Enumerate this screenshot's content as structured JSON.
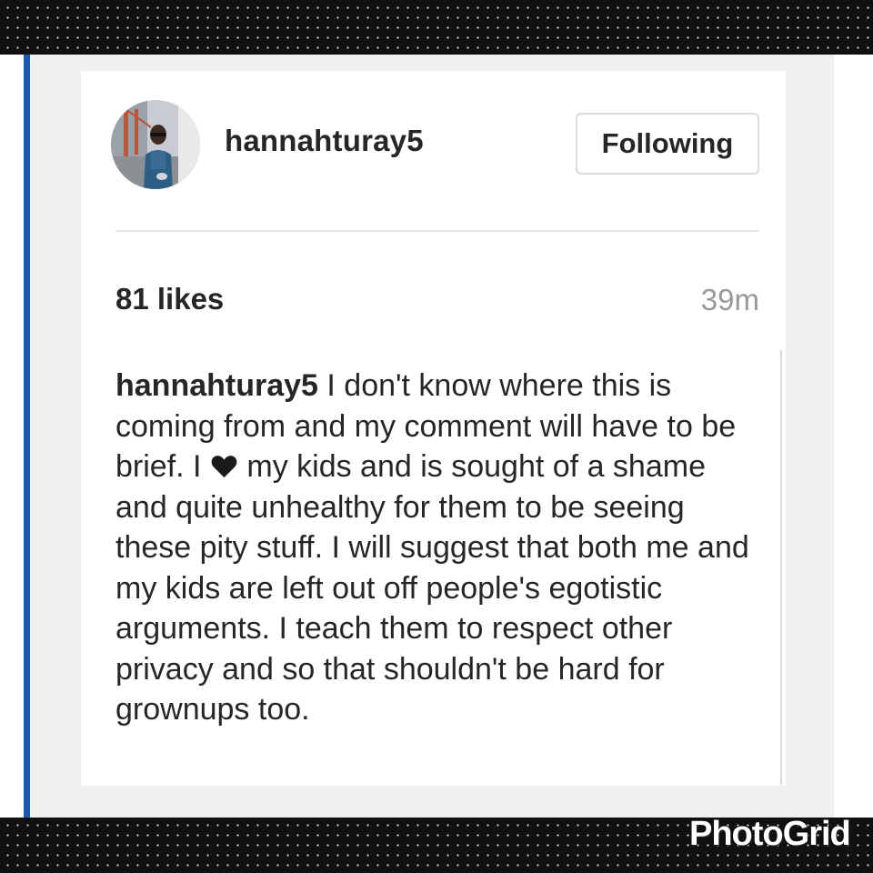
{
  "post": {
    "username": "hannahturay5",
    "follow_label": "Following",
    "likes": "81 likes",
    "time_ago": "39m",
    "caption": {
      "username": "hannahturay5",
      "before_heart": " I don't know where this is coming from and my comment will have to be brief. I ",
      "heart_icon": "heart-icon",
      "after_heart": " my kids and is sought of a shame and quite unhealthy for them to be seeing these pity stuff. I will suggest that both me and my kids are left out off people's egotistic arguments. I teach them to respect other privacy and so that shouldn't be hard for grownups too."
    }
  },
  "watermark": "PhotoGrid",
  "colors": {
    "accent_line": "#1d57b0",
    "text": "#262626",
    "muted": "#999999",
    "button_border": "#dbdbdb"
  }
}
